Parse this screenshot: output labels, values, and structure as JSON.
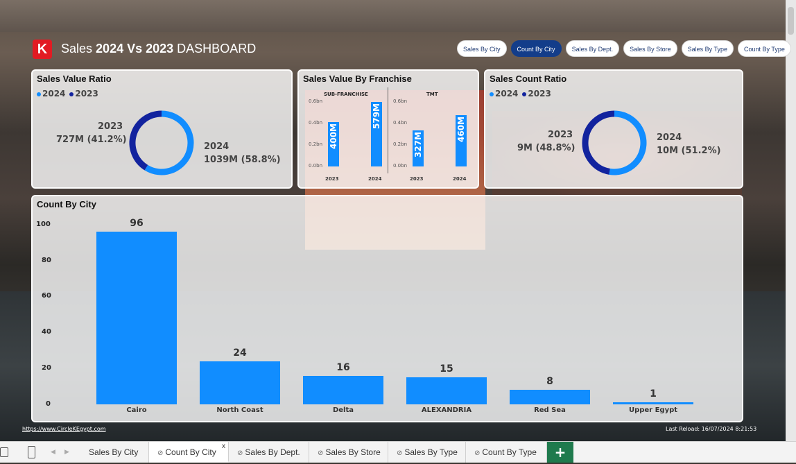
{
  "header": {
    "logo": "K",
    "title_prefix": "Sales",
    "title_bold": "2024 Vs 2023",
    "title_suffix": "DASHBOARD"
  },
  "nav_buttons": [
    {
      "label": "Sales By City",
      "active": false
    },
    {
      "label": "Count By City",
      "active": true
    },
    {
      "label": "Sales By Dept.",
      "active": false
    },
    {
      "label": "Sales By Store",
      "active": false
    },
    {
      "label": "Sales By Type",
      "active": false
    },
    {
      "label": "Count By Type",
      "active": false
    }
  ],
  "colors": {
    "y2024": "#118dff",
    "y2023": "#12239e",
    "accent": "#133d8a",
    "logo": "#e21b23"
  },
  "sales_value_ratio": {
    "title": "Sales Value Ratio",
    "legend": [
      "2024",
      "2023"
    ],
    "label_2023_year": "2023",
    "label_2023_value": "727M (41.2%)",
    "label_2024_year": "2024",
    "label_2024_value": "1039M (58.8%)"
  },
  "sales_value_franchise": {
    "title": "Sales Value By Franchise",
    "groups": [
      "SUB-FRANCHISE",
      "TMT"
    ],
    "ticks": [
      "0.6bn",
      "0.4bn",
      "0.2bn",
      "0.0bn"
    ],
    "years": [
      "2023",
      "2024",
      "2023",
      "2024"
    ],
    "value_labels": [
      "400M",
      "579M",
      "327M",
      "460M"
    ]
  },
  "sales_count_ratio": {
    "title": "Sales Count Ratio",
    "legend": [
      "2024",
      "2023"
    ],
    "label_2023_year": "2023",
    "label_2023_value": "9M (48.8%)",
    "label_2024_year": "2024",
    "label_2024_value": "10M (51.2%)"
  },
  "count_by_city": {
    "title": "Count By City",
    "ticks": [
      "100",
      "80",
      "60",
      "40",
      "20",
      "0"
    ]
  },
  "chart_data": [
    {
      "type": "pie",
      "title": "Sales Value Ratio",
      "categories": [
        "2024",
        "2023"
      ],
      "values": [
        1039,
        727
      ],
      "percent": [
        58.8,
        41.2
      ]
    },
    {
      "type": "bar",
      "title": "Sales Value By Franchise",
      "categories": [
        "SUB-FRANCHISE 2023",
        "SUB-FRANCHISE 2024",
        "TMT 2023",
        "TMT 2024"
      ],
      "values": [
        400,
        579,
        327,
        460
      ],
      "ylim": [
        0,
        0.6
      ]
    },
    {
      "type": "pie",
      "title": "Sales Count Ratio",
      "categories": [
        "2024",
        "2023"
      ],
      "values": [
        10,
        9
      ],
      "percent": [
        51.2,
        48.8
      ]
    },
    {
      "type": "bar",
      "title": "Count By City",
      "categories": [
        "Cairo",
        "North Coast",
        "Delta",
        "ALEXANDRIA",
        "Red Sea",
        "Upper Egypt"
      ],
      "values": [
        96,
        24,
        16,
        15,
        8,
        1
      ],
      "ylim": [
        0,
        100
      ]
    }
  ],
  "footer": {
    "link": "https://www.CircleKEgypt.com",
    "reload": "Last Reload: 16/07/2024 8:21:53"
  },
  "tabs": [
    {
      "label": "Sales By City",
      "hidden": false,
      "active": false
    },
    {
      "label": "Count By City",
      "hidden": true,
      "active": true
    },
    {
      "label": "Sales By Dept.",
      "hidden": true,
      "active": false
    },
    {
      "label": "Sales By Store",
      "hidden": true,
      "active": false
    },
    {
      "label": "Sales By Type",
      "hidden": true,
      "active": false
    },
    {
      "label": "Count By Type",
      "hidden": true,
      "active": false
    }
  ],
  "add_tab": "+",
  "close_tab": "x"
}
